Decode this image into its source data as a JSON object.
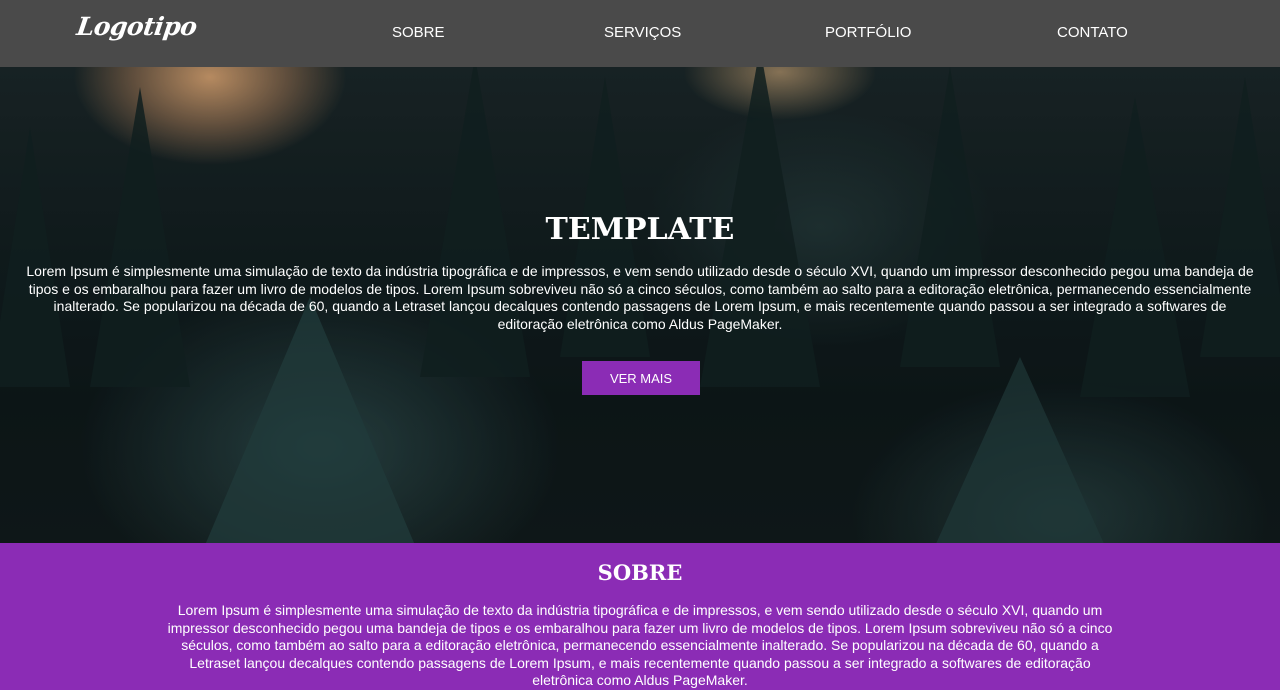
{
  "nav": {
    "logo": "Logotipo",
    "links": [
      "SOBRE",
      "SERVIÇOS",
      "PORTFÓLIO",
      "CONTATO"
    ]
  },
  "hero": {
    "title": "TEMPLATE",
    "text": "Lorem Ipsum é simplesmente uma simulação de texto da indústria tipográfica e de impressos, e vem sendo utilizado desde o século XVI, quando um impressor desconhecido pegou uma bandeja de tipos e os embaralhou para fazer um livro de modelos de tipos. Lorem Ipsum sobreviveu não só a cinco séculos, como também ao salto para a editoração eletrônica, permanecendo essencialmente inalterado. Se popularizou na década de 60, quando a Letraset lançou decalques contendo passagens de Lorem Ipsum, e mais recentemente quando passou a ser integrado a softwares de editoração eletrônica como Aldus PageMaker.",
    "button_label": "VER MAIS"
  },
  "sobre": {
    "title": "SOBRE",
    "text": "Lorem Ipsum é simplesmente uma simulação de texto da indústria tipográfica e de impressos, e vem sendo utilizado desde o século XVI, quando um impressor desconhecido pegou uma bandeja de tipos e os embaralhou para fazer um livro de modelos de tipos. Lorem Ipsum sobreviveu não só a cinco séculos, como também ao salto para a editoração eletrônica, permanecendo essencialmente inalterado. Se popularizou na década de 60, quando a Letraset lançou decalques contendo passagens de Lorem Ipsum, e mais recentemente quando passou a ser integrado a softwares de editoração eletrônica como Aldus PageMaker."
  },
  "colors": {
    "navbar": "#4a4a4a",
    "accent": "#8b2cb5",
    "text": "#ffffff"
  }
}
